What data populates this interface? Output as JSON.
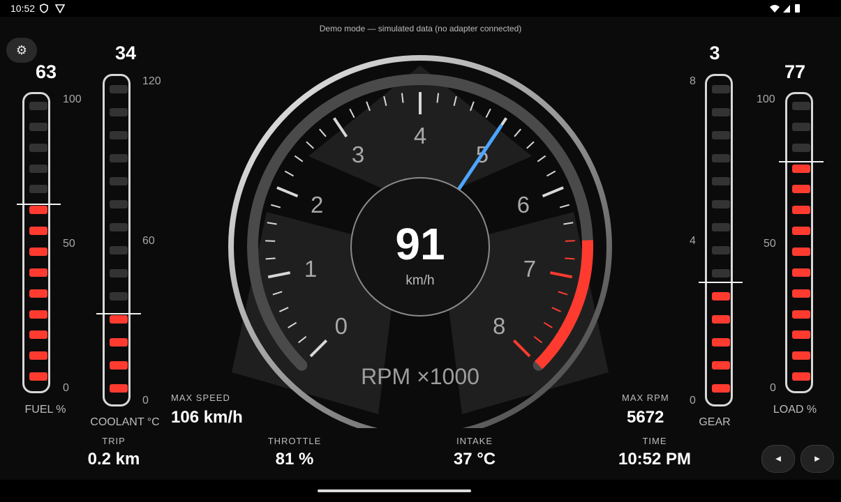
{
  "status": {
    "time": "10:52"
  },
  "header": {
    "settings_icon": "gear-icon",
    "demo_note": "Demo mode — simulated data (no adapter connected)"
  },
  "gauge": {
    "speed": "91",
    "speed_unit": "km/h",
    "rpm_label": "RPM ×1000",
    "rpm_ticks": [
      "0",
      "1",
      "2",
      "3",
      "4",
      "5",
      "6",
      "7",
      "8"
    ],
    "rpm_value_x1000": 5.0,
    "redline_from_x1000": 6.6,
    "needle_color": "#4da6ff",
    "redline_color": "#ff3b30"
  },
  "bars": {
    "fuel": {
      "value": "63",
      "label": "FUEL %",
      "max": "100",
      "mid": "50",
      "min": "0",
      "fraction": 0.63
    },
    "coolant": {
      "value": "34",
      "label": "COOLANT °C",
      "max": "120",
      "mid": "60",
      "min": "0",
      "fraction": 0.28
    },
    "gear": {
      "value": "3",
      "label": "GEAR",
      "max": "8",
      "mid": "4",
      "min": "0",
      "fraction": 0.375
    },
    "load": {
      "value": "77",
      "label": "LOAD %",
      "max": "100",
      "mid": "50",
      "min": "0",
      "fraction": 0.77
    }
  },
  "stats": {
    "max_speed": {
      "label": "MAX SPEED",
      "value": "106 km/h"
    },
    "max_rpm": {
      "label": "MAX RPM",
      "value": "5672"
    },
    "trip": {
      "label": "TRIP",
      "value": "0.2 km"
    },
    "throttle": {
      "label": "THROTTLE",
      "value": "81 %"
    },
    "intake": {
      "label": "INTAKE",
      "value": "37 °C"
    },
    "time": {
      "label": "TIME",
      "value": "10:52 PM"
    }
  },
  "nav": {
    "prev_icon": "◄",
    "next_icon": "►"
  },
  "colors": {
    "accent_red": "#ff3b30",
    "needle_blue": "#4da6ff"
  }
}
